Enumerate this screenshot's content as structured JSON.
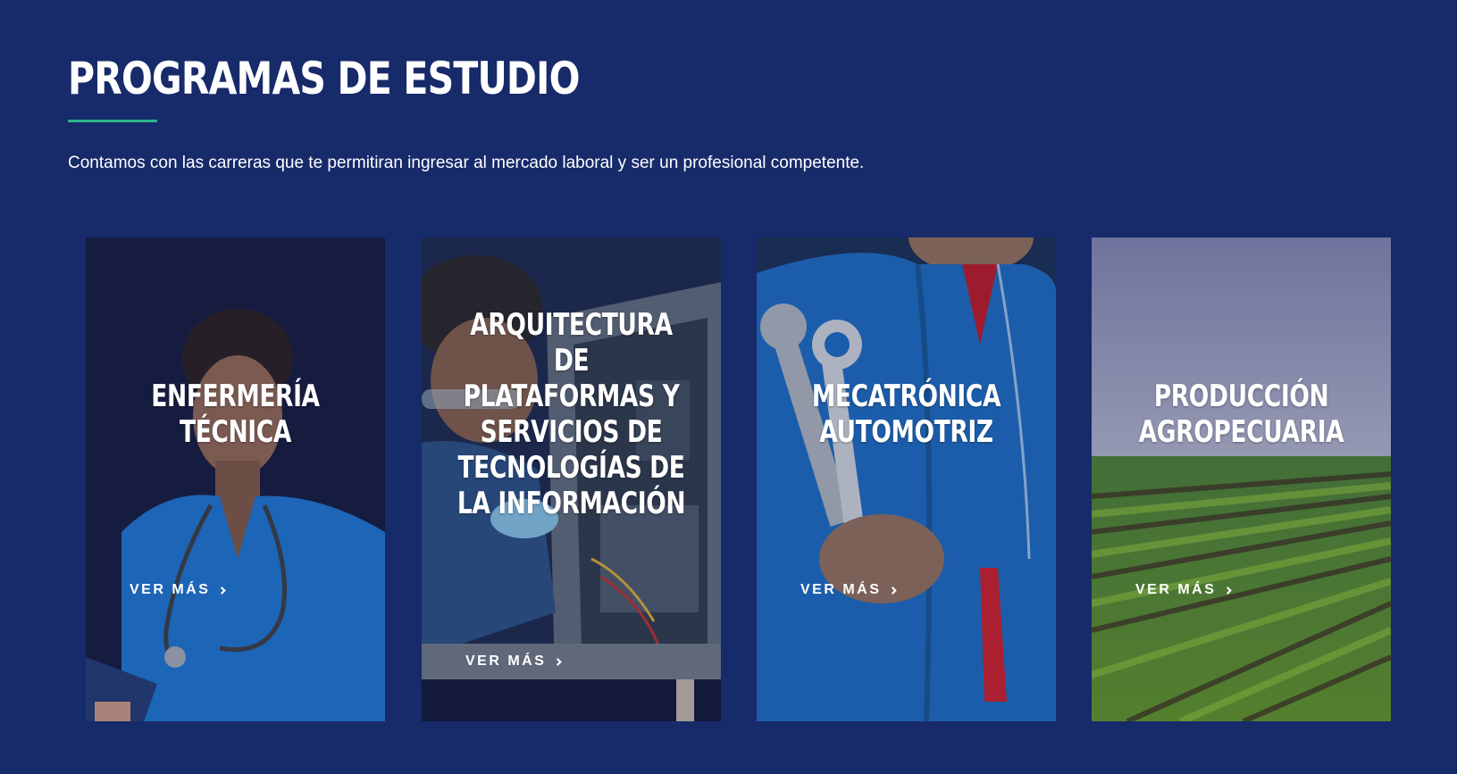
{
  "section": {
    "title": "PROGRAMAS DE ESTUDIO",
    "intro": "Contamos con las carreras que te permitiran ingresar al mercado laboral y ser un profesional competente."
  },
  "cards": [
    {
      "title_lines": [
        "ENFERMERÍA",
        "TÉCNICA"
      ],
      "cta": "VER MÁS",
      "image": "nurse-photo"
    },
    {
      "title_lines": [
        "ARQUITECTURA",
        "DE",
        "PLATAFORMAS Y",
        "SERVICIOS DE",
        "TECNOLOGÍAS DE",
        "LA INFORMACIÓN"
      ],
      "cta": "VER MÁS",
      "image": "technician-computer-photo"
    },
    {
      "title_lines": [
        "MECATRÓNICA",
        "AUTOMOTRIZ"
      ],
      "cta": "VER MÁS",
      "image": "mechanic-wrench-photo"
    },
    {
      "title_lines": [
        "PRODUCCIÓN",
        "AGROPECUARIA"
      ],
      "cta": "VER MÁS",
      "image": "crop-field-photo"
    }
  ],
  "colors": {
    "background": "#172a6a",
    "accent": "#2bb58a",
    "text": "#ffffff"
  },
  "icons": {
    "cta_icon": "chevron-right-icon"
  }
}
